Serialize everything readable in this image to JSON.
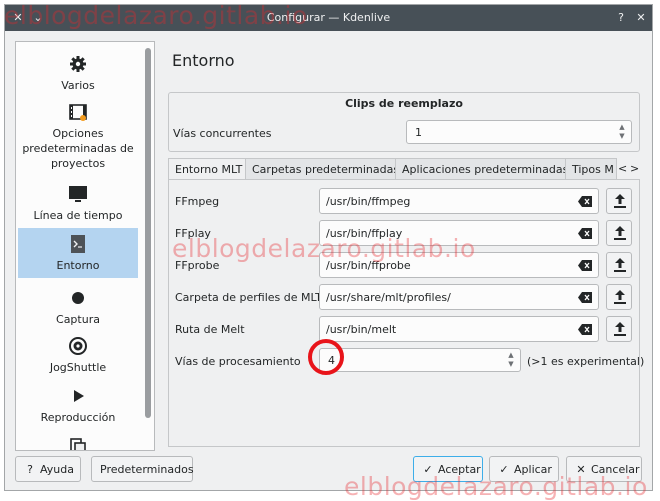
{
  "watermark": "elblogdelazaro.gitlab.io",
  "titlebar": {
    "title": "Configurar — Kdenlive"
  },
  "sidebar": {
    "items": [
      {
        "label": "Varios",
        "icon": "gear-icon"
      },
      {
        "label": "Opciones predeterminadas de proyectos",
        "icon": "film-project-icon"
      },
      {
        "label": "Línea de tiempo",
        "icon": "monitor-icon"
      },
      {
        "label": "Entorno",
        "icon": "terminal-icon",
        "active": true
      },
      {
        "label": "Captura",
        "icon": "record-dot-icon"
      },
      {
        "label": "JogShuttle",
        "icon": "jog-wheel-icon"
      },
      {
        "label": "Reproducción",
        "icon": "play-icon"
      },
      {
        "label": "",
        "icon": "copy-icon"
      }
    ]
  },
  "page": {
    "title": "Entorno"
  },
  "proxy_group": {
    "title": "Clips de reemplazo",
    "concurrent_label": "Vías concurrentes",
    "concurrent_value": "1"
  },
  "tabs": [
    "Entorno MLT",
    "Carpetas predeterminadas",
    "Aplicaciones predeterminadas",
    "Tipos M"
  ],
  "tab_nav": {
    "left": "<",
    "right": ">"
  },
  "fields": [
    {
      "label": "FFmpeg",
      "value": "/usr/bin/ffmpeg"
    },
    {
      "label": "FFplay",
      "value": "/usr/bin/ffplay"
    },
    {
      "label": "FFprobe",
      "value": "/usr/bin/ffprobe"
    },
    {
      "label": "Carpeta de perfiles de MLT",
      "value": "/usr/share/mlt/profiles/"
    },
    {
      "label": "Ruta de Melt",
      "value": "/usr/bin/melt"
    }
  ],
  "threads": {
    "label": "Vías de procesamiento",
    "value": "4",
    "hint": "(>1 es experimental)"
  },
  "buttons": {
    "help": "Ayuda",
    "defaults": "Predeterminados",
    "ok": "Aceptar",
    "apply": "Aplicar",
    "cancel": "Cancelar"
  },
  "colors": {
    "titlebar": "#475057",
    "selection": "#b4d4f0",
    "annotation": "#e8141a",
    "watermark": "#e8262b"
  }
}
